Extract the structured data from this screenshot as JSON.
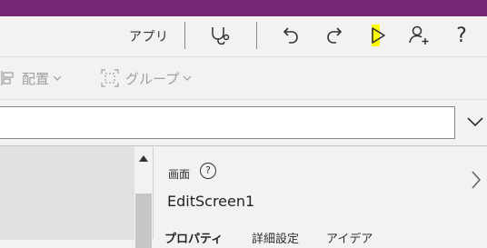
{
  "titlebar": {
    "color": "#742774"
  },
  "command_bar": {
    "app_label": "アプリ",
    "icons": [
      {
        "name": "app-checker-icon"
      },
      {
        "name": "undo-icon"
      },
      {
        "name": "redo-icon"
      },
      {
        "name": "preview-play-icon",
        "highlighted": true,
        "highlight_color": "#ffff00"
      },
      {
        "name": "share-user-icon"
      },
      {
        "name": "help-icon",
        "glyph": "?"
      }
    ]
  },
  "ribbon": {
    "align_label": "配置",
    "group_label": "グループ",
    "state": "disabled"
  },
  "formula_bar": {
    "value": ""
  },
  "properties_panel": {
    "type_label": "画面",
    "help_glyph": "?",
    "object_name": "EditScreen1",
    "tabs": [
      {
        "label": "プロパティ",
        "active": true
      },
      {
        "label": "詳細設定",
        "active": false
      },
      {
        "label": "アイデア",
        "active": false
      }
    ]
  }
}
